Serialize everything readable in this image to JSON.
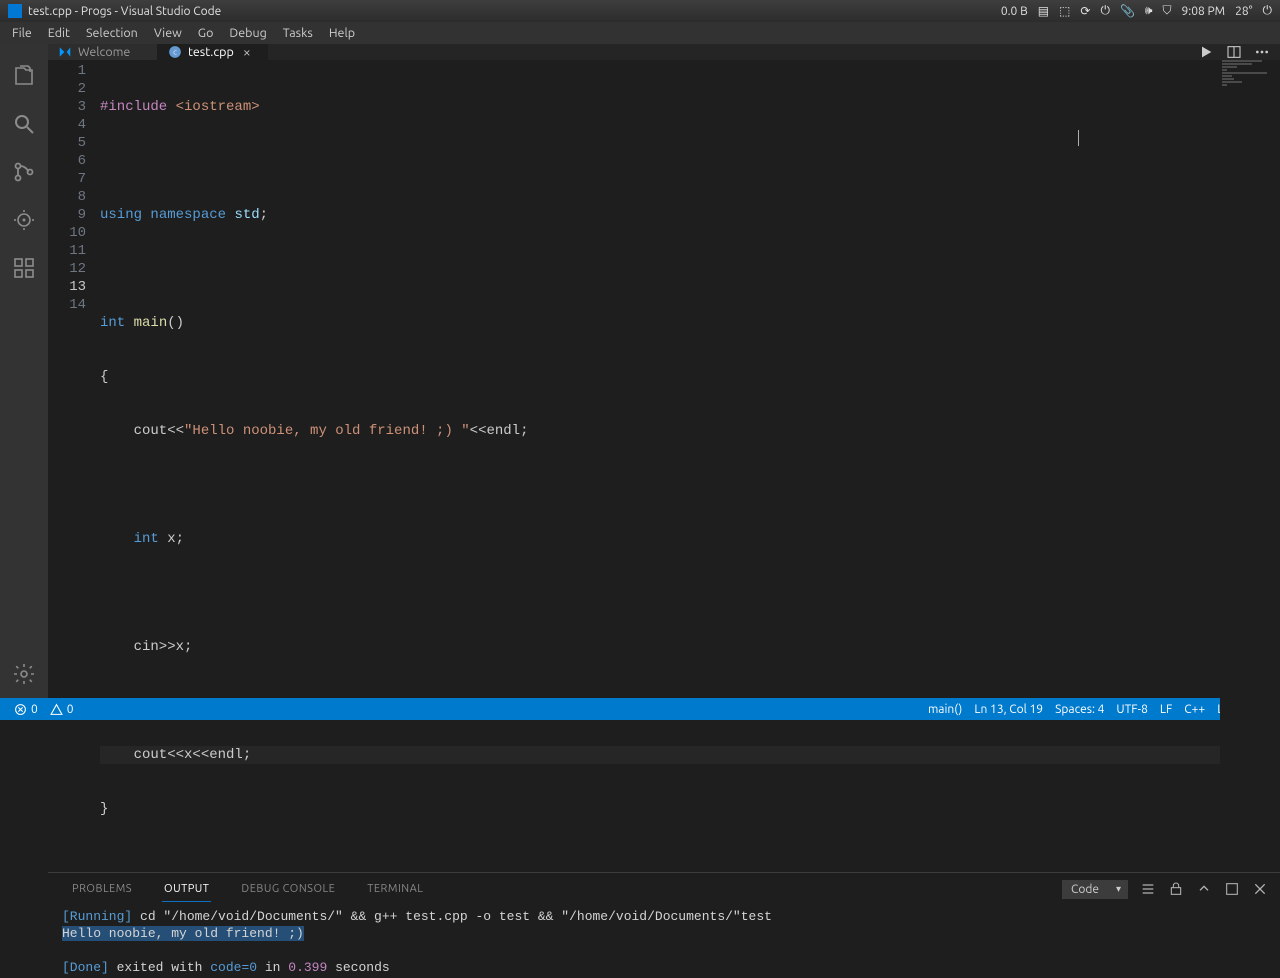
{
  "os_bar": {
    "title": "test.cpp - Progs - Visual Studio Code",
    "net_speed": "0.0 B",
    "time": "9:08 PM",
    "temp": "28°"
  },
  "menu": {
    "items": [
      "File",
      "Edit",
      "Selection",
      "View",
      "Go",
      "Debug",
      "Tasks",
      "Help"
    ]
  },
  "tabs": {
    "items": [
      {
        "label": "Welcome",
        "active": false
      },
      {
        "label": "test.cpp",
        "active": true,
        "closeable": true
      }
    ]
  },
  "editor": {
    "current_line": 13,
    "lines": [
      {
        "n": 1
      },
      {
        "n": 2
      },
      {
        "n": 3
      },
      {
        "n": 4
      },
      {
        "n": 5
      },
      {
        "n": 6
      },
      {
        "n": 7
      },
      {
        "n": 8
      },
      {
        "n": 9
      },
      {
        "n": 10
      },
      {
        "n": 11
      },
      {
        "n": 12
      },
      {
        "n": 13
      },
      {
        "n": 14
      }
    ],
    "code": {
      "l1": {
        "a": "#include",
        "b": "<iostream>"
      },
      "l3": {
        "a": "using",
        "b": "namespace",
        "c": "std",
        "d": ";"
      },
      "l5": {
        "a": "int",
        "b": "main",
        "c": "()"
      },
      "l6": "{",
      "l7": {
        "a": "    cout<<",
        "b": "\"Hello noobie, my old friend! ;) \"",
        "c": "<<endl;"
      },
      "l9": {
        "a": "    ",
        "b": "int",
        "c": " x;"
      },
      "l11": "    cin>>x;",
      "l13": "    cout<<x<<endl;",
      "l14": "}"
    }
  },
  "panel": {
    "tabs": [
      "PROBLEMS",
      "OUTPUT",
      "DEBUG CONSOLE",
      "TERMINAL"
    ],
    "active_tab": "OUTPUT",
    "selector": "Code",
    "output": {
      "run_label": "[Running]",
      "run_cmd": " cd \"/home/void/Documents/\" && g++ test.cpp -o test && \"/home/void/Documents/\"test",
      "hello": "Hello noobie, my old friend! ;) ",
      "done_label": "[Done]",
      "done_rest1": " exited with ",
      "done_code": "code=0",
      "done_in": " in ",
      "done_time": "0.399",
      "done_sec": " seconds"
    }
  },
  "status": {
    "errors": "0",
    "warnings": "0",
    "scope": "main()",
    "cursor": "Ln 13, Col 19",
    "spaces": "Spaces: 4",
    "encoding": "UTF-8",
    "eol": "LF",
    "lang": "C++",
    "os": "Linux"
  }
}
